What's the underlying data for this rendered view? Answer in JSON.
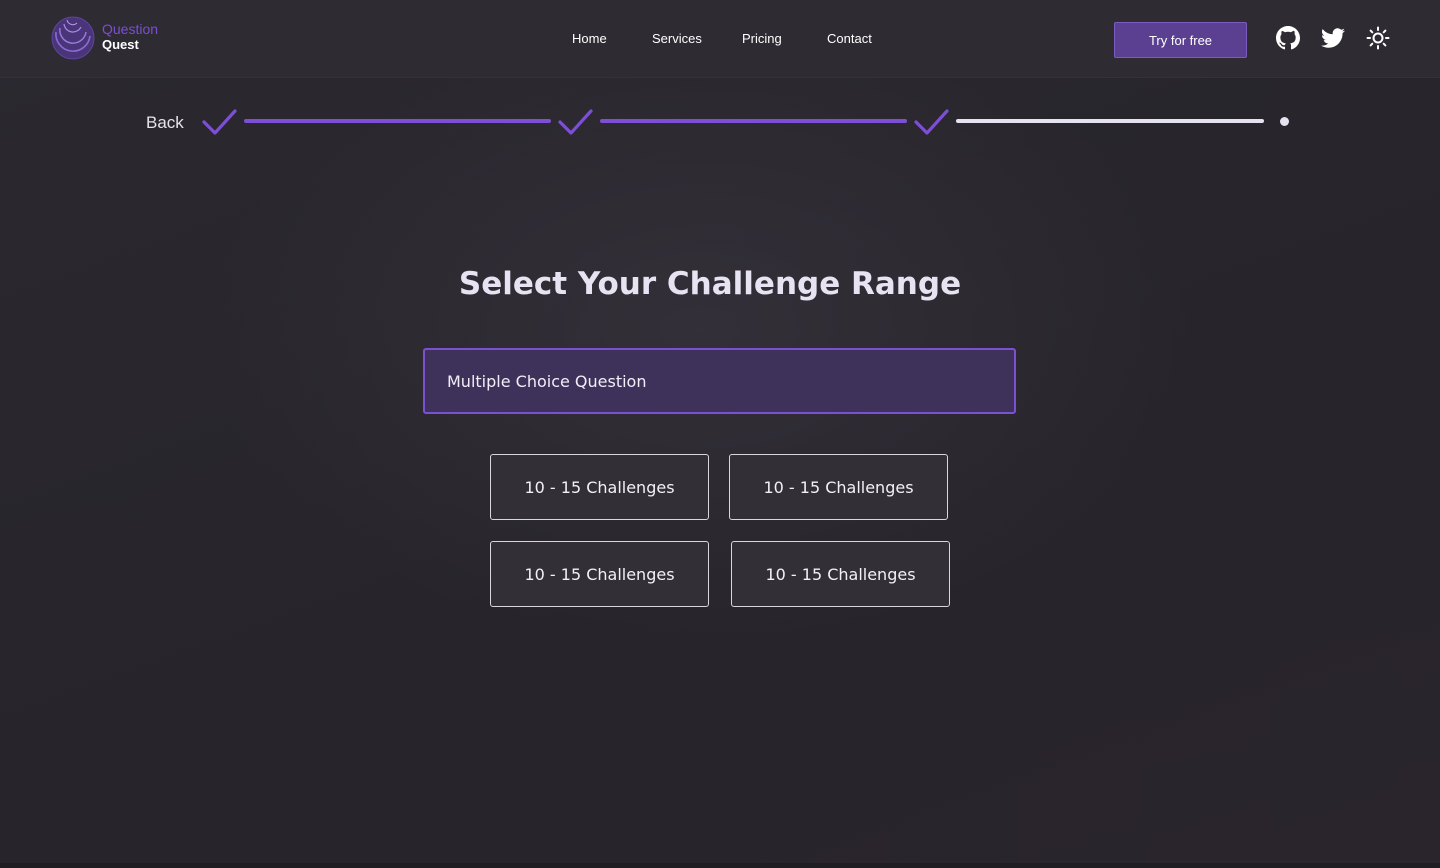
{
  "brand": {
    "word1": "Question",
    "word2": "Quest",
    "accent_color": "#7b50d4"
  },
  "nav": {
    "links": [
      "Home",
      "Services",
      "Pricing",
      "Contact"
    ],
    "cta_label": "Try for free",
    "icons": [
      "github-icon",
      "twitter-icon",
      "sun-icon"
    ]
  },
  "progress": {
    "back_label": "Back",
    "steps_completed": 3,
    "steps_total": 4
  },
  "main": {
    "title": "Select Your Challenge Range",
    "question_type": "Multiple Choice Question",
    "options": [
      "10 - 15 Challenges",
      "10 - 15 Challenges",
      "10 - 15 Challenges",
      "10 - 15 Challenges"
    ]
  }
}
